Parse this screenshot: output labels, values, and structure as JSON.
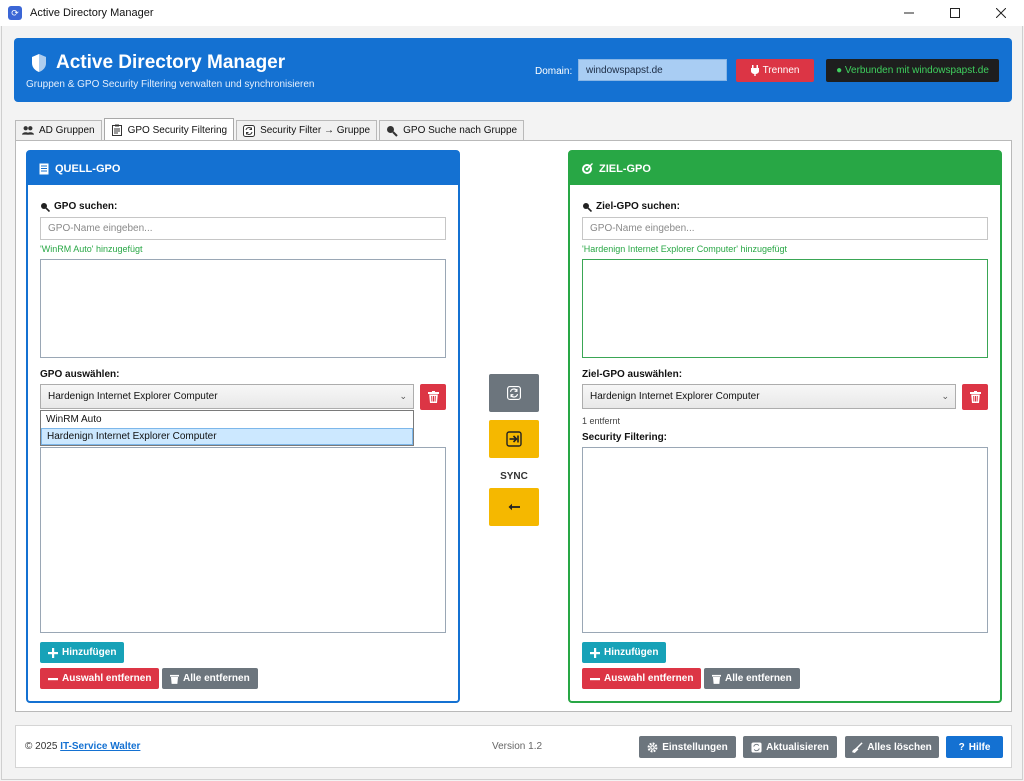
{
  "window": {
    "title": "Active Directory Manager"
  },
  "header": {
    "title": "Active Directory Manager",
    "subtitle": "Gruppen & GPO Security Filtering verwalten und synchronisieren",
    "domain_label": "Domain:",
    "domain_value": "windowspapst.de",
    "disconnect_label": "Trennen",
    "status_text": "● Verbunden mit windowspapst.de",
    "status_color": "#3fd05e"
  },
  "tabs": [
    {
      "label": "AD Gruppen",
      "icon": "users-icon"
    },
    {
      "label": "GPO Security Filtering",
      "icon": "clipboard-icon",
      "active": true
    },
    {
      "label": "Security Filter → Gruppe",
      "icon": "sync-icon"
    },
    {
      "label": "GPO Suche nach Gruppe",
      "icon": "search-icon"
    }
  ],
  "source": {
    "title": "QUELL-GPO",
    "search_label": "GPO suchen:",
    "search_placeholder": "GPO-Name eingeben...",
    "hint": "'WinRM Auto' hinzugefügt",
    "select_label": "GPO auswählen:",
    "selected": "Hardenign Internet Explorer Computer",
    "options": [
      "WinRM Auto",
      "Hardenign Internet Explorer Computer"
    ],
    "add_label": "Hinzufügen",
    "remove_label": "Auswahl entfernen",
    "remove_all_label": "Alle entfernen"
  },
  "target": {
    "title": "ZIEL-GPO",
    "search_label": "Ziel-GPO suchen:",
    "search_placeholder": "GPO-Name eingeben...",
    "hint": "'Hardenign Internet Explorer Computer' hinzugefügt",
    "select_label": "Ziel-GPO auswählen:",
    "selected": "Hardenign Internet Explorer Computer",
    "removed_count": "1 entfernt",
    "filtering_label": "Security Filtering:",
    "add_label": "Hinzufügen",
    "remove_label": "Auswahl entfernen",
    "remove_all_label": "Alle entfernen"
  },
  "middle": {
    "sync_label": "SYNC"
  },
  "footer": {
    "copyright": "© 2025",
    "company": "IT-Service Walter",
    "version": "Version 1.2",
    "settings_label": "Einstellungen",
    "refresh_label": "Aktualisieren",
    "clear_all_label": "Alles löschen",
    "help_label": "Hilfe"
  },
  "colors": {
    "primary": "#1471d2",
    "success": "#28a745",
    "danger": "#dc3545",
    "warning": "#f5b800",
    "info": "#17a2b8",
    "secondary": "#6c757d"
  }
}
